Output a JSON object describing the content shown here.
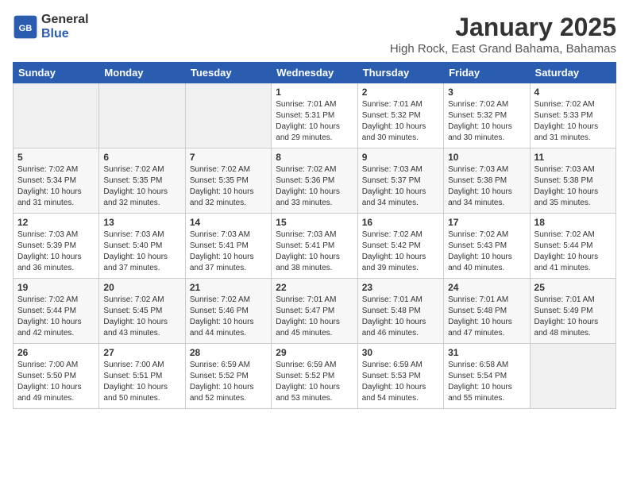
{
  "header": {
    "logo_general": "General",
    "logo_blue": "Blue",
    "month_title": "January 2025",
    "location": "High Rock, East Grand Bahama, Bahamas"
  },
  "weekdays": [
    "Sunday",
    "Monday",
    "Tuesday",
    "Wednesday",
    "Thursday",
    "Friday",
    "Saturday"
  ],
  "weeks": [
    [
      {
        "day": "",
        "info": ""
      },
      {
        "day": "",
        "info": ""
      },
      {
        "day": "",
        "info": ""
      },
      {
        "day": "1",
        "info": "Sunrise: 7:01 AM\nSunset: 5:31 PM\nDaylight: 10 hours\nand 29 minutes."
      },
      {
        "day": "2",
        "info": "Sunrise: 7:01 AM\nSunset: 5:32 PM\nDaylight: 10 hours\nand 30 minutes."
      },
      {
        "day": "3",
        "info": "Sunrise: 7:02 AM\nSunset: 5:32 PM\nDaylight: 10 hours\nand 30 minutes."
      },
      {
        "day": "4",
        "info": "Sunrise: 7:02 AM\nSunset: 5:33 PM\nDaylight: 10 hours\nand 31 minutes."
      }
    ],
    [
      {
        "day": "5",
        "info": "Sunrise: 7:02 AM\nSunset: 5:34 PM\nDaylight: 10 hours\nand 31 minutes."
      },
      {
        "day": "6",
        "info": "Sunrise: 7:02 AM\nSunset: 5:35 PM\nDaylight: 10 hours\nand 32 minutes."
      },
      {
        "day": "7",
        "info": "Sunrise: 7:02 AM\nSunset: 5:35 PM\nDaylight: 10 hours\nand 32 minutes."
      },
      {
        "day": "8",
        "info": "Sunrise: 7:02 AM\nSunset: 5:36 PM\nDaylight: 10 hours\nand 33 minutes."
      },
      {
        "day": "9",
        "info": "Sunrise: 7:03 AM\nSunset: 5:37 PM\nDaylight: 10 hours\nand 34 minutes."
      },
      {
        "day": "10",
        "info": "Sunrise: 7:03 AM\nSunset: 5:38 PM\nDaylight: 10 hours\nand 34 minutes."
      },
      {
        "day": "11",
        "info": "Sunrise: 7:03 AM\nSunset: 5:38 PM\nDaylight: 10 hours\nand 35 minutes."
      }
    ],
    [
      {
        "day": "12",
        "info": "Sunrise: 7:03 AM\nSunset: 5:39 PM\nDaylight: 10 hours\nand 36 minutes."
      },
      {
        "day": "13",
        "info": "Sunrise: 7:03 AM\nSunset: 5:40 PM\nDaylight: 10 hours\nand 37 minutes."
      },
      {
        "day": "14",
        "info": "Sunrise: 7:03 AM\nSunset: 5:41 PM\nDaylight: 10 hours\nand 37 minutes."
      },
      {
        "day": "15",
        "info": "Sunrise: 7:03 AM\nSunset: 5:41 PM\nDaylight: 10 hours\nand 38 minutes."
      },
      {
        "day": "16",
        "info": "Sunrise: 7:02 AM\nSunset: 5:42 PM\nDaylight: 10 hours\nand 39 minutes."
      },
      {
        "day": "17",
        "info": "Sunrise: 7:02 AM\nSunset: 5:43 PM\nDaylight: 10 hours\nand 40 minutes."
      },
      {
        "day": "18",
        "info": "Sunrise: 7:02 AM\nSunset: 5:44 PM\nDaylight: 10 hours\nand 41 minutes."
      }
    ],
    [
      {
        "day": "19",
        "info": "Sunrise: 7:02 AM\nSunset: 5:44 PM\nDaylight: 10 hours\nand 42 minutes."
      },
      {
        "day": "20",
        "info": "Sunrise: 7:02 AM\nSunset: 5:45 PM\nDaylight: 10 hours\nand 43 minutes."
      },
      {
        "day": "21",
        "info": "Sunrise: 7:02 AM\nSunset: 5:46 PM\nDaylight: 10 hours\nand 44 minutes."
      },
      {
        "day": "22",
        "info": "Sunrise: 7:01 AM\nSunset: 5:47 PM\nDaylight: 10 hours\nand 45 minutes."
      },
      {
        "day": "23",
        "info": "Sunrise: 7:01 AM\nSunset: 5:48 PM\nDaylight: 10 hours\nand 46 minutes."
      },
      {
        "day": "24",
        "info": "Sunrise: 7:01 AM\nSunset: 5:48 PM\nDaylight: 10 hours\nand 47 minutes."
      },
      {
        "day": "25",
        "info": "Sunrise: 7:01 AM\nSunset: 5:49 PM\nDaylight: 10 hours\nand 48 minutes."
      }
    ],
    [
      {
        "day": "26",
        "info": "Sunrise: 7:00 AM\nSunset: 5:50 PM\nDaylight: 10 hours\nand 49 minutes."
      },
      {
        "day": "27",
        "info": "Sunrise: 7:00 AM\nSunset: 5:51 PM\nDaylight: 10 hours\nand 50 minutes."
      },
      {
        "day": "28",
        "info": "Sunrise: 6:59 AM\nSunset: 5:52 PM\nDaylight: 10 hours\nand 52 minutes."
      },
      {
        "day": "29",
        "info": "Sunrise: 6:59 AM\nSunset: 5:52 PM\nDaylight: 10 hours\nand 53 minutes."
      },
      {
        "day": "30",
        "info": "Sunrise: 6:59 AM\nSunset: 5:53 PM\nDaylight: 10 hours\nand 54 minutes."
      },
      {
        "day": "31",
        "info": "Sunrise: 6:58 AM\nSunset: 5:54 PM\nDaylight: 10 hours\nand 55 minutes."
      },
      {
        "day": "",
        "info": ""
      }
    ]
  ]
}
